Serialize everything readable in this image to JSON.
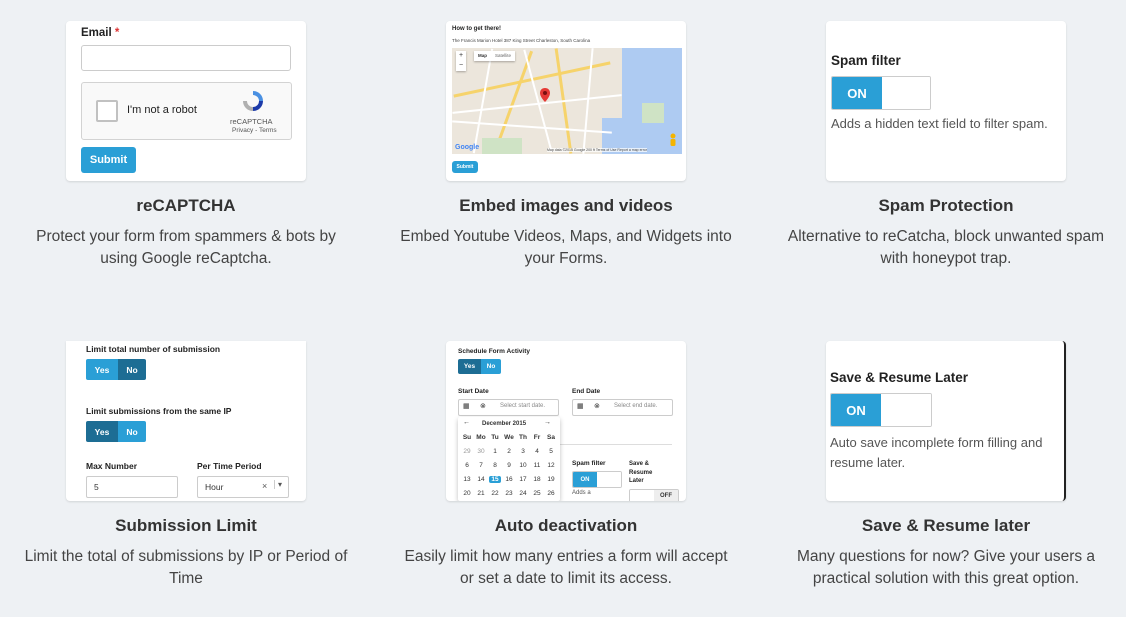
{
  "features": [
    {
      "title": "reCAPTCHA",
      "desc": "Protect your form from spammers & bots by using Google reCaptcha.",
      "preview": {
        "email_label": "Email",
        "required_mark": "*",
        "captcha_text": "I'm not a robot",
        "captcha_brand": "reCAPTCHA",
        "captcha_links": "Privacy - Terms",
        "submit_label": "Submit"
      }
    },
    {
      "title": "Embed images and videos",
      "desc": "Embed Youtube Videos, Maps, and Widgets into your Forms.",
      "preview": {
        "heading": "How to get there!",
        "address": "The Francis Marion Hotel 387 King Street Charleston, South Carolina",
        "map_tab": "Map",
        "satellite_tab": "Satellite",
        "zoom_in": "+",
        "zoom_out": "−",
        "google_label": "Google",
        "map_footer": "Map data ©2015 Google   200 ft  Terms of Use   Report a map error",
        "submit_label": "Submit"
      }
    },
    {
      "title": "Spam Protection",
      "desc": "Alternative to reCatcha, block unwanted spam with honeypot trap.",
      "preview": {
        "label": "Spam filter",
        "on_label": "ON",
        "hint": "Adds a hidden text field to filter spam."
      }
    },
    {
      "title": "Submission Limit",
      "desc": "Limit the total of submissions by IP or Period of Time",
      "preview": {
        "limit_total_label": "Limit total number of submission",
        "yes": "Yes",
        "no": "No",
        "limit_ip_label": "Limit submissions from the same IP",
        "max_number_label": "Max Number",
        "max_number_value": "5",
        "period_label": "Per Time Period",
        "period_value": "Hour",
        "clear": "×",
        "caret": "▾"
      }
    },
    {
      "title": "Auto deactivation",
      "desc": "Easily limit how many entries a form will accept or set a date to limit its access.",
      "preview": {
        "schedule_label": "Schedule Form Activity",
        "yes": "Yes",
        "no": "No",
        "start_label": "Start Date",
        "start_placeholder": "Select start date.",
        "end_label": "End Date",
        "end_placeholder": "Select end date.",
        "month": "December 2015",
        "prev": "←",
        "next": "→",
        "weekdays": [
          "Su",
          "Mo",
          "Tu",
          "We",
          "Th",
          "Fr",
          "Sa"
        ],
        "weeks": [
          [
            "29",
            "30",
            "1",
            "2",
            "3",
            "4",
            "5"
          ],
          [
            "6",
            "7",
            "8",
            "9",
            "10",
            "11",
            "12"
          ],
          [
            "13",
            "14",
            "15",
            "16",
            "17",
            "18",
            "19"
          ],
          [
            "20",
            "21",
            "22",
            "23",
            "24",
            "25",
            "26"
          ]
        ],
        "selected_day": "15",
        "spam_label": "Spam filter",
        "on_label": "ON",
        "adds_text": "Adds a",
        "save_label": "Save & Resume Later",
        "off_label": "OFF"
      }
    },
    {
      "title": "Save & Resume later",
      "desc": "Many questions for now? Give your users a practical solution with this great option.",
      "preview": {
        "label": "Save & Resume Later",
        "on_label": "ON",
        "hint": "Auto save incomplete form filling and resume later."
      }
    }
  ],
  "colors": {
    "accent": "#2a9fd6",
    "dark_accent": "#1d6d94",
    "background": "#eef1f4"
  },
  "icons": {
    "calendar": "calendar-icon",
    "clear": "clear-circle-icon",
    "recaptcha": "recaptcha-logo-icon",
    "map_pin": "map-pin-icon",
    "pegman": "pegman-icon"
  }
}
